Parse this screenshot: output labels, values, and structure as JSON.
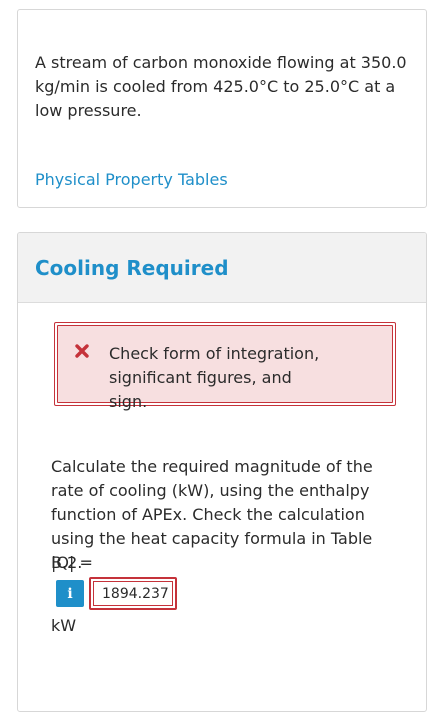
{
  "problem": {
    "text": "A stream of carbon monoxide flowing at 350.0 kg/min is cooled from 425.0°C to 25.0°C at a low pressure.",
    "link_label": "Physical Property Tables"
  },
  "part": {
    "title": "Cooling Required",
    "feedback": {
      "icon": "x-icon",
      "text": "Check form of integration, significant figures, and sign."
    },
    "question": "Calculate the required magnitude of the rate of cooling (kW), using the enthalpy function of APEx. Check the calculation using the heat capacity formula in Table B.2.",
    "answer_label": "|Q| =",
    "info_icon": "i",
    "answer_value": "1894.237",
    "unit": "kW"
  },
  "colors": {
    "link": "#1f8fc9",
    "error": "#c5323a",
    "error_bg": "#f7dfe0",
    "header_bg": "#f2f2f2"
  }
}
